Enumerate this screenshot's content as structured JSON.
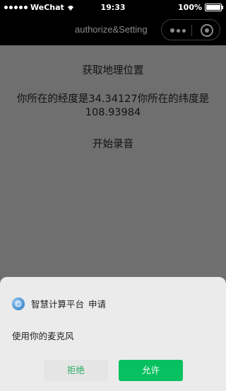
{
  "status_bar": {
    "carrier": "WeChat",
    "time": "19:33",
    "battery": "100%",
    "battery_level": 1.0
  },
  "nav": {
    "title": "authorize&Setting"
  },
  "page": {
    "location_button": "获取地理位置",
    "coordinates_text": "你所在的经度是34.34127你所在的纬度是108.93984",
    "record_button": "开始录音"
  },
  "auth_sheet": {
    "app_name": "智慧计算平台",
    "action": "申请",
    "permission": "使用你的麦克风",
    "reject_label": "拒绝",
    "allow_label": "允许"
  },
  "colors": {
    "overlay": "#6f6f6f",
    "accent": "#07c160",
    "reject_text": "#2aae67"
  }
}
